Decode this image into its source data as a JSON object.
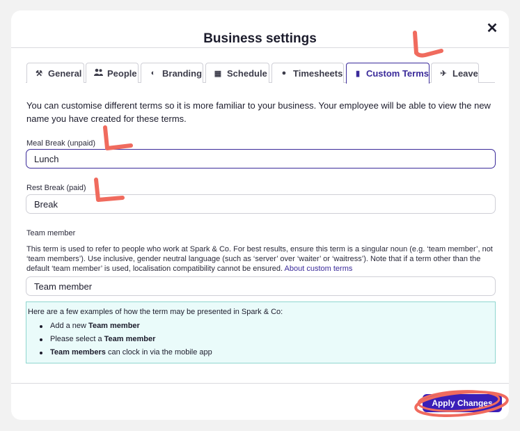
{
  "modal": {
    "title": "Business settings",
    "close_glyph": "✕"
  },
  "tabs": [
    {
      "label": "General",
      "icon": "tools-icon",
      "glyph": "⚒"
    },
    {
      "label": "People",
      "icon": "people-icon",
      "glyph": "👥"
    },
    {
      "label": "Branding",
      "icon": "palette-icon",
      "glyph": "◐"
    },
    {
      "label": "Schedule",
      "icon": "calendar-icon",
      "glyph": "▦"
    },
    {
      "label": "Timesheets",
      "icon": "clock-icon",
      "glyph": "●"
    },
    {
      "label": "Custom Terms",
      "icon": "book-icon",
      "glyph": "▮",
      "active": true
    },
    {
      "label": "Leave",
      "icon": "plane-icon",
      "glyph": "✈"
    }
  ],
  "intro": "You can customise different terms so it is more familiar to your business. Your employee will be able to view the new name you have created for these terms.",
  "fields": {
    "meal_break": {
      "label": "Meal Break (unpaid)",
      "value": "Lunch"
    },
    "rest_break": {
      "label": "Rest Break (paid)",
      "value": "Break"
    },
    "team_member": {
      "label": "Team member",
      "value": "Team member"
    }
  },
  "help": {
    "text": "This term is used to refer to people who work at Spark & Co. For best results, ensure this term is a singular noun (e.g. ‘team member’, not ‘team members’). Use inclusive, gender neutral language (such as ‘server’ over ‘waiter’ or ‘waitress’). Note that if a term other than the default ‘team member’ is used, localisation compatibility cannot be ensured.",
    "link": "About custom terms"
  },
  "examples": {
    "intro": "Here are a few examples of how the term may be presented in Spark & Co:",
    "items": [
      {
        "before": "Add a new ",
        "term": "Team member",
        "after": ""
      },
      {
        "before": "Please select a ",
        "term": "Team member",
        "after": ""
      },
      {
        "before": "",
        "term": "Team members",
        "after": " can clock in via the mobile app"
      }
    ]
  },
  "footer": {
    "apply_label": "Apply Changes"
  },
  "colors": {
    "accent": "#3a1fb8",
    "annotation": "#f06b5e",
    "examples_bg": "#eafbfa"
  }
}
